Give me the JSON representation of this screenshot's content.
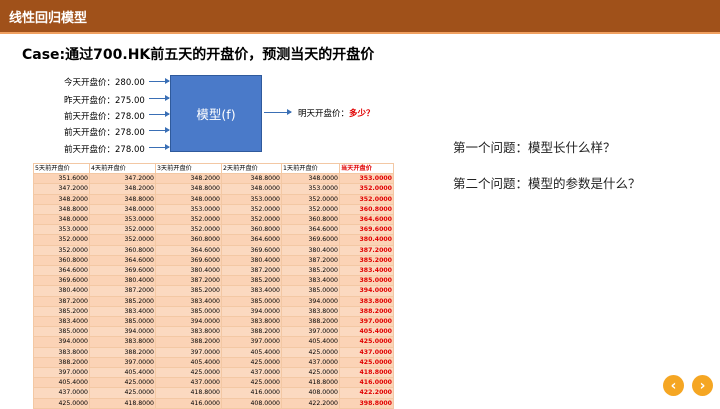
{
  "header": {
    "title": "线性回归模型"
  },
  "case_title": "Case:通过700.HK前五天的开盘价，预测当天的开盘价",
  "inputs": [
    {
      "label": "今天开盘价：",
      "value": "280.00"
    },
    {
      "label": "昨天开盘价：",
      "value": "275.00"
    },
    {
      "label": "前天开盘价：",
      "value": "278.00"
    },
    {
      "label": "前天开盘价：",
      "value": "278.00"
    },
    {
      "label": "前天开盘价：",
      "value": "278.00"
    }
  ],
  "model_label": "模型(f)",
  "output": {
    "label": "明天开盘价：",
    "value": "多少？"
  },
  "questions": [
    "第一个问题：模型长什么样？",
    "第二个问题：模型的参数是什么？"
  ],
  "table": {
    "headers": [
      "5天前开盘价",
      "4天前开盘价",
      "3天前开盘价",
      "2天前开盘价",
      "1天前开盘价",
      "当天开盘价"
    ],
    "rows": [
      [
        "351.6000",
        "347.2000",
        "348.2000",
        "348.8000",
        "348.0000",
        "353.0000"
      ],
      [
        "347.2000",
        "348.2000",
        "348.8000",
        "348.0000",
        "353.0000",
        "352.0000"
      ],
      [
        "348.2000",
        "348.8000",
        "348.0000",
        "353.0000",
        "352.0000",
        "352.0000"
      ],
      [
        "348.8000",
        "348.0000",
        "353.0000",
        "352.0000",
        "352.0000",
        "360.8000"
      ],
      [
        "348.0000",
        "353.0000",
        "352.0000",
        "352.0000",
        "360.8000",
        "364.6000"
      ],
      [
        "353.0000",
        "352.0000",
        "352.0000",
        "360.8000",
        "364.6000",
        "369.6000"
      ],
      [
        "352.0000",
        "352.0000",
        "360.8000",
        "364.6000",
        "369.6000",
        "380.4000"
      ],
      [
        "352.0000",
        "360.8000",
        "364.6000",
        "369.6000",
        "380.4000",
        "387.2000"
      ],
      [
        "360.8000",
        "364.6000",
        "369.6000",
        "380.4000",
        "387.2000",
        "385.2000"
      ],
      [
        "364.6000",
        "369.6000",
        "380.4000",
        "387.2000",
        "385.2000",
        "383.4000"
      ],
      [
        "369.6000",
        "380.4000",
        "387.2000",
        "385.2000",
        "383.4000",
        "385.0000"
      ],
      [
        "380.4000",
        "387.2000",
        "385.2000",
        "383.4000",
        "385.0000",
        "394.0000"
      ],
      [
        "387.2000",
        "385.2000",
        "383.4000",
        "385.0000",
        "394.0000",
        "383.8000"
      ],
      [
        "385.2000",
        "383.4000",
        "385.0000",
        "394.0000",
        "383.8000",
        "388.2000"
      ],
      [
        "383.4000",
        "385.0000",
        "394.0000",
        "383.8000",
        "388.2000",
        "397.0000"
      ],
      [
        "385.0000",
        "394.0000",
        "383.8000",
        "388.2000",
        "397.0000",
        "405.4000"
      ],
      [
        "394.0000",
        "383.8000",
        "388.2000",
        "397.0000",
        "405.4000",
        "425.0000"
      ],
      [
        "383.8000",
        "388.2000",
        "397.0000",
        "405.4000",
        "425.0000",
        "437.0000"
      ],
      [
        "388.2000",
        "397.0000",
        "405.4000",
        "425.0000",
        "437.0000",
        "425.0000"
      ],
      [
        "397.0000",
        "405.4000",
        "425.0000",
        "437.0000",
        "425.0000",
        "418.8000"
      ],
      [
        "405.4000",
        "425.0000",
        "437.0000",
        "425.0000",
        "418.8000",
        "416.0000"
      ],
      [
        "437.0000",
        "425.0000",
        "418.8000",
        "416.0000",
        "408.0000",
        "422.2000"
      ],
      [
        "425.0000",
        "418.8000",
        "416.0000",
        "408.0000",
        "422.2000",
        "398.8000"
      ]
    ]
  },
  "nav": {
    "prev": "‹",
    "next": "›"
  },
  "colors": {
    "header": "#a0511a",
    "model_box": "#4a7ac9",
    "highlight": "#e00000",
    "nav": "#f5a623"
  }
}
